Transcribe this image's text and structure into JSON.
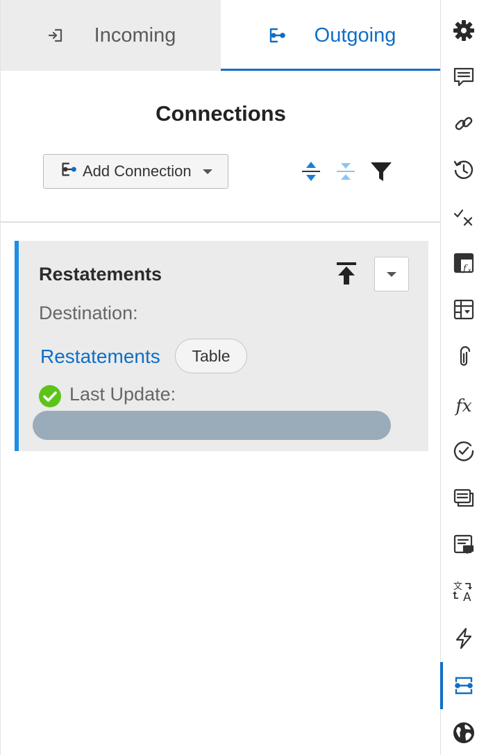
{
  "tabs": [
    {
      "label": "Incoming",
      "icon": "sign-in-icon",
      "active": false
    },
    {
      "label": "Outgoing",
      "icon": "sign-out-icon",
      "active": true
    }
  ],
  "header": {
    "title": "Connections",
    "add_connection_label": "Add Connection"
  },
  "toolbar": {
    "expand_all_icon": "expand-all-icon",
    "collapse_all_icon": "collapse-all-icon",
    "filter_icon": "filter-icon"
  },
  "connection": {
    "name": "Restatements",
    "destination_label": "Destination:",
    "destination_name": "Restatements",
    "destination_type": "Table",
    "last_update_label": "Last Update:",
    "status": "success"
  },
  "rail": {
    "items": [
      {
        "name": "settings",
        "icon": "gear-icon"
      },
      {
        "name": "comments",
        "icon": "comment-icon"
      },
      {
        "name": "links",
        "icon": "link-icon"
      },
      {
        "name": "history",
        "icon": "history-icon"
      },
      {
        "name": "validation",
        "icon": "check-x-icon"
      },
      {
        "name": "table-formula",
        "icon": "table-formula-icon"
      },
      {
        "name": "table-dropdown",
        "icon": "table-dropdown-icon"
      },
      {
        "name": "attachments",
        "icon": "paperclip-icon"
      },
      {
        "name": "formulas",
        "icon": "fx-icon",
        "text": "fx"
      },
      {
        "name": "review",
        "icon": "check-circle-icon"
      },
      {
        "name": "list",
        "icon": "list-icon"
      },
      {
        "name": "notes",
        "icon": "note-icon"
      },
      {
        "name": "translate",
        "icon": "translate-icon"
      },
      {
        "name": "automation",
        "icon": "lightning-icon"
      },
      {
        "name": "connections",
        "icon": "connection-icon",
        "active": true
      },
      {
        "name": "globe",
        "icon": "globe-icon"
      }
    ]
  },
  "colors": {
    "accent": "#0f6ec6",
    "card_border": "#1a8fe3",
    "success": "#5cc419",
    "redacted": "#9aabba"
  }
}
